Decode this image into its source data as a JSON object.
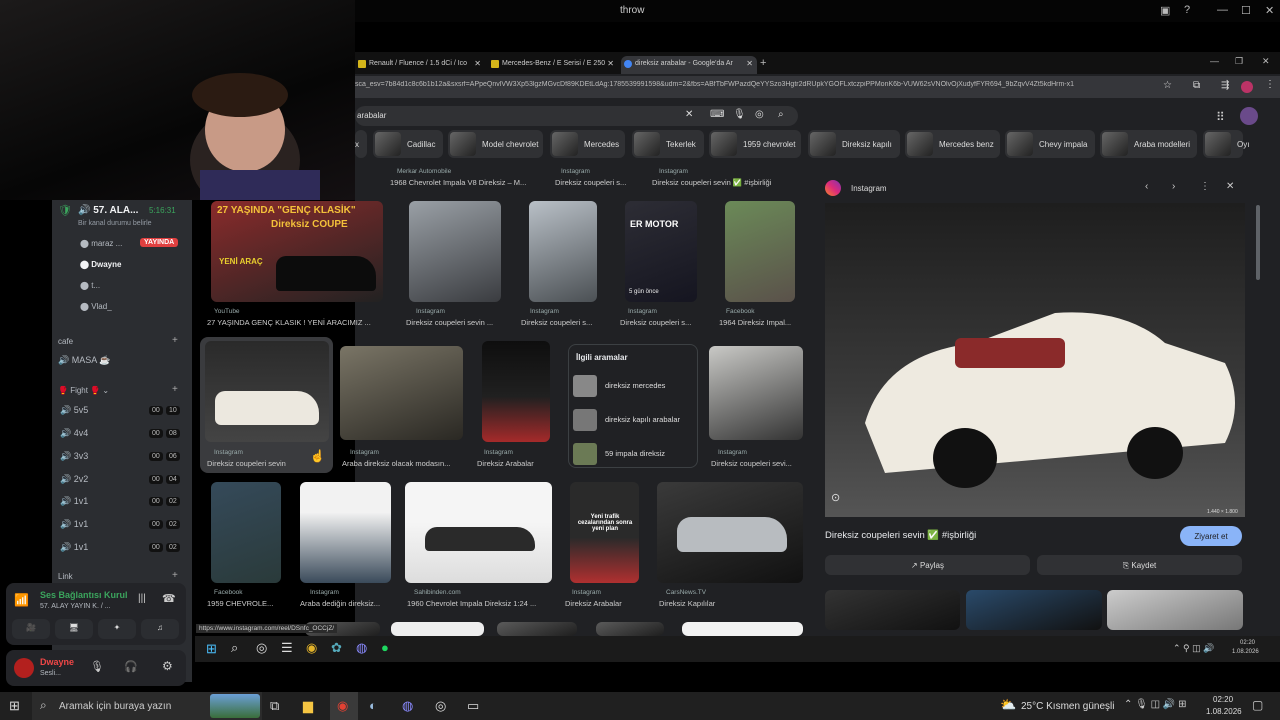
{
  "window": {
    "title": "throw"
  },
  "tabs": [
    {
      "label": "Renault / Fluence / 1.5 dCi / Ico"
    },
    {
      "label": "Mercedes-Benz / E Serisi / E 250"
    },
    {
      "label": "direksiz arabalar - Google'da Ar"
    }
  ],
  "url": "sca_esv=7b84d1c8c6b1b12a&sxsrf=APpeQnvlVW3Xp53lgzMGvcDf89KDEtLdAg:1785539991598&udm=2&fbs=ABfTbFWPazdQeYYSzo3Hgtr2dRUpkYGOFLxtczpiPPMonK6b-VUW62sVNOlvOjXudyfFYR694_9bZqvV4Zt5kdHrm-x1",
  "search": {
    "query": "arabalar"
  },
  "chips": [
    "Cadillac",
    "Model chevrolet",
    "Mercedes",
    "Tekerlek",
    "1959 chevrolet",
    "Direksiz kapılı",
    "Mercedes benz",
    "Chevy impala",
    "Araba modelleri",
    "Oyı"
  ],
  "results": [
    {
      "src": "YouTube",
      "cap": "27 YAŞINDA GENÇ KLASIK ! YENİ ARACIMIZ ...",
      "overlay": "27 YAŞINDA \"GENÇ KLASİK\"",
      "overlay2": "Direksiz COUPE",
      "tag": "YENİ ARAÇ"
    },
    {
      "src": "Instagram",
      "cap": "Direksiz coupeleri sevin ..."
    },
    {
      "src": "Instagram",
      "cap": "Direksiz coupeleri s..."
    },
    {
      "src": "Instagram",
      "cap": "Direksiz coupeleri s...",
      "overlay": "ER MOTOR",
      "tag": "5 gün önce"
    },
    {
      "src": "Facebook",
      "cap": "1964 Direksiz Impal..."
    },
    {
      "src": "Instagram",
      "cap": "Direksiz coupeleri sevin"
    },
    {
      "src": "Instagram",
      "cap": "Araba direksiz olacak modasın..."
    },
    {
      "src": "Instagram",
      "cap": "Direksiz Arabalar"
    },
    {
      "src": "Instagram",
      "cap": "Direksiz coupeleri sevi..."
    },
    {
      "src": "Facebook",
      "cap": "1959 CHEVROLE..."
    },
    {
      "src": "Instagram",
      "cap": "Araba dediğin direksiz..."
    },
    {
      "src": "Sahibinden.com",
      "cap": "1960 Chevrolet Impala Direksiz 1:24 ..."
    },
    {
      "src": "Instagram",
      "cap": "Direksiz Arabalar",
      "overlay": "Yeni trafik cezalarından sonra yeni plan"
    },
    {
      "src": "CarsNews.TV",
      "cap": "Direksiz Kapılılar"
    }
  ],
  "top_row": [
    {
      "src": "Merkar Automobile",
      "cap": "1968 Chevrolet Impala V8 Direksiz – M..."
    },
    {
      "src": "Instagram",
      "cap": "Direksiz coupeleri s..."
    },
    {
      "src": "Instagram",
      "cap": "Direksiz coupeleri sevin ✅ #işbirliği"
    }
  ],
  "related": {
    "title": "İlgili aramalar",
    "items": [
      "direksiz mercedes",
      "direksiz kapılı arabalar",
      "59 impala direksiz"
    ]
  },
  "preview": {
    "source": "Instagram",
    "caption": "Direksiz coupeleri sevin ✅ #işbirliği",
    "visit": "Ziyaret et",
    "share": "Paylaş",
    "save": "Kaydet",
    "size": "1.440 × 1.800"
  },
  "status_url": "https://www.instagram.com/reel/DSnfc_OCCjZ/",
  "discord": {
    "voice_channel": "57. ALA...",
    "timer": "5:16:31",
    "subtitle": "Bir kanal durumu belirle",
    "users": [
      "maraz ...",
      "Dwayne",
      "t...",
      "Vlad_"
    ],
    "live": "YAYINDA",
    "cat1": "cafe",
    "masa": "MASA ☕",
    "cat2": "Fight",
    "channels": [
      {
        "n": "5v5",
        "a": "00",
        "b": "10"
      },
      {
        "n": "4v4",
        "a": "00",
        "b": "08"
      },
      {
        "n": "3v3",
        "a": "00",
        "b": "06"
      },
      {
        "n": "2v2",
        "a": "00",
        "b": "04"
      },
      {
        "n": "1v1",
        "a": "00",
        "b": "02"
      },
      {
        "n": "1v1",
        "a": "00",
        "b": "02"
      },
      {
        "n": "1v1",
        "a": "00",
        "b": "02"
      }
    ],
    "cat3": "Link",
    "voice_status": "Ses Bağlantısı Kurul",
    "voice_sub": "57. ALAY YAYIN K. / ...",
    "me": "Dwayne",
    "me_status": "Sesli..."
  },
  "taskbar": {
    "search": "Aramak için buraya yazın",
    "weather": "25°C  Kısmen güneşli",
    "time": "02:20",
    "date": "1.08.2026"
  }
}
